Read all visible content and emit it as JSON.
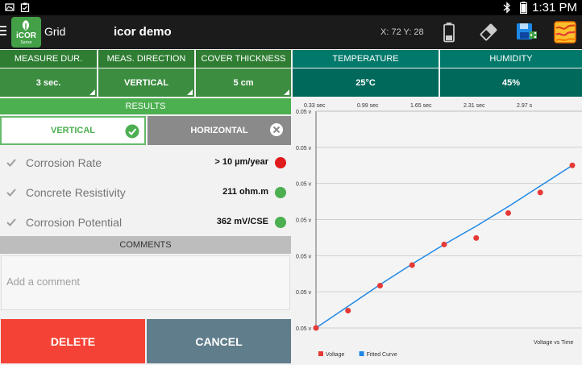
{
  "status_bar": {
    "time": "1:31 PM"
  },
  "action_bar": {
    "logo_text": "iCOR",
    "logo_sub": "Sense",
    "app_title": "Grid",
    "document_title": "icor demo",
    "coordinates": "X: 72 Y: 28",
    "icons": [
      "battery-icon",
      "eraser-icon",
      "save-sync-icon",
      "map-icon"
    ]
  },
  "settings": [
    {
      "label": "MEASURE DUR.",
      "value": "3 sec."
    },
    {
      "label": "MEAS. DIRECTION",
      "value": "VERTICAL"
    },
    {
      "label": "COVER THICKNESS",
      "value": "5 cm"
    }
  ],
  "conditions": [
    {
      "label": "TEMPERATURE",
      "value": "25°C"
    },
    {
      "label": "HUMIDITY",
      "value": "45%"
    }
  ],
  "results": {
    "header": "RESULTS",
    "tabs": {
      "vertical": "VERTICAL",
      "horizontal": "HORIZONTAL",
      "selected": "VERTICAL"
    },
    "rows": [
      {
        "label": "Corrosion Rate",
        "value": "> 10 µm/year",
        "status_color": "#e01b1b",
        "checked": true
      },
      {
        "label": "Concrete Resistivity",
        "value": "211 ohm.m",
        "status_color": "#4caf50",
        "checked": true
      },
      {
        "label": "Corrosion Potential",
        "value": "362 mV/CSE",
        "status_color": "#4caf50",
        "checked": true
      }
    ]
  },
  "comments": {
    "header": "COMMENTS",
    "placeholder": "Add a comment",
    "value": ""
  },
  "buttons": {
    "delete": "DELETE",
    "cancel": "CANCEL"
  },
  "colors": {
    "green_dark": "#2e7d32",
    "green": "#4caf50",
    "teal": "#00796b",
    "delete": "#f44336",
    "cancel": "#607d8b",
    "voltage_series": "#e53935",
    "fitted_series": "#1e88e5"
  },
  "chart_data": {
    "type": "scatter",
    "title": "Voltage vs Time",
    "x_tick_labels": [
      "0.33 sec",
      "0.99 sec",
      "1.65 sec",
      "2.31 sec",
      "2.97 s"
    ],
    "y_tick_labels": [
      "0.05 v",
      "0.05 v",
      "0.05 v",
      "0.05 v",
      "0.05 v",
      "0.05 v",
      "0.05 v"
    ],
    "grid": true,
    "legend_position": "bottom-left",
    "series": [
      {
        "name": "Voltage",
        "kind": "points",
        "color": "#e53935",
        "y": [
          0.0,
          0.08,
          0.195,
          0.29,
          0.385,
          0.415,
          0.53,
          0.625,
          0.75
        ]
      },
      {
        "name": "Fitted Curve",
        "kind": "line",
        "color": "#1e88e5",
        "y": [
          0.0,
          0.1,
          0.2,
          0.295,
          0.385,
          0.47,
          0.56,
          0.655,
          0.75
        ]
      }
    ]
  }
}
